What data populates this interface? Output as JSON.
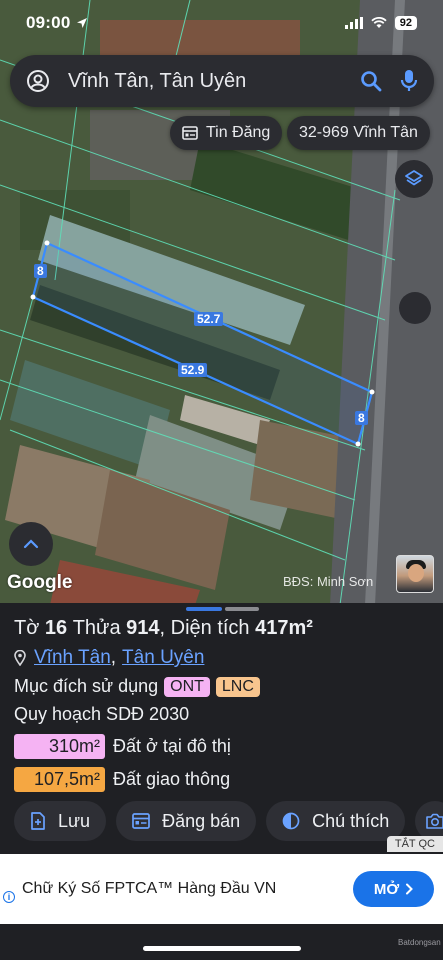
{
  "status_bar": {
    "time": "09:00",
    "battery": "92"
  },
  "search": {
    "query": "Vĩnh Tân, Tân Uyên"
  },
  "chips": {
    "posts_label": "Tin Đăng",
    "address_label": "32-969 Vĩnh Tân"
  },
  "map": {
    "edge_labels": {
      "top": "52.7",
      "bottom": "52.9",
      "left": "8",
      "right": "8"
    },
    "attribution": "Google",
    "watermark": "BĐS: Minh Sơn"
  },
  "parcel": {
    "sheet_label": "Tờ",
    "sheet_no": "16",
    "lot_label": "Thửa",
    "lot_no": "914",
    "area_label": ", Diện tích",
    "area_value": "417m²",
    "commune": "Vĩnh Tân",
    "district": "Tân Uyên",
    "purpose_label": "Mục đích sử dụng",
    "tags": [
      "ONT",
      "LNC"
    ],
    "plan_label": "Quy hoạch SDĐ 2030",
    "zones": [
      {
        "area": "310m²",
        "name": "Đất ở tại đô thị",
        "color": "#f5b3f3"
      },
      {
        "area": "107,5m²",
        "name": "Đất giao thông",
        "color": "#f5a742"
      }
    ]
  },
  "actions": {
    "save": "Lưu",
    "post": "Đăng bán",
    "legend": "Chú thích"
  },
  "ad": {
    "close": "TẮT QC",
    "text": "Chữ Ký Số FPTCA™ Hàng Đầu VN",
    "cta": "MỞ",
    "brand": "Batdongsan"
  },
  "colors": {
    "accent": "#3a78e0",
    "link": "#6aa2ff",
    "panel": "#1f2024",
    "chip": "#2b2c31"
  }
}
